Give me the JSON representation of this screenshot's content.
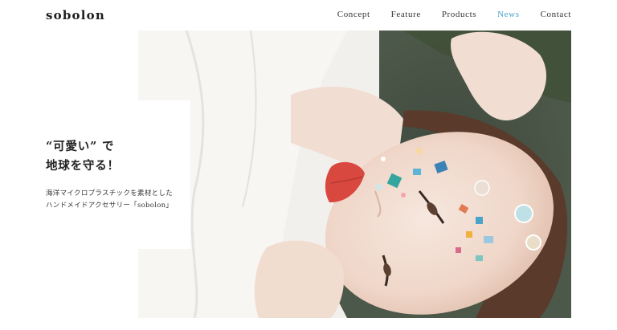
{
  "header": {
    "logo": "sobolon",
    "nav": [
      {
        "label": "Concept"
      },
      {
        "label": "Feature"
      },
      {
        "label": "Products"
      },
      {
        "label": "News"
      },
      {
        "label": "Contact"
      }
    ]
  },
  "hero": {
    "catch_line1": "“可愛い” で",
    "catch_line2": "地球を守る！",
    "desc_line1": "海洋マイクロプラスチックを素材とした",
    "desc_line2": "ハンドメイドアクセサリー「sobolon」"
  },
  "colors": {
    "accent": "#4aa3c9",
    "text": "#222222",
    "background": "#ffffff"
  }
}
